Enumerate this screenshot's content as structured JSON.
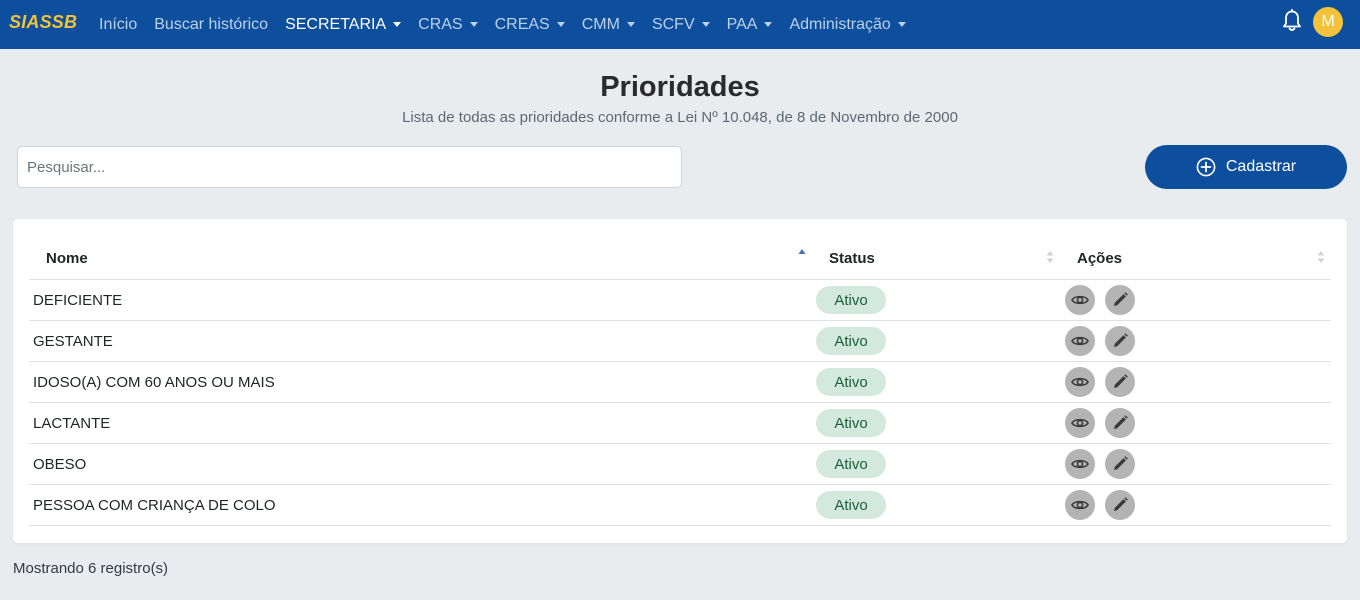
{
  "navbar": {
    "brand": "SIASSB",
    "items": [
      {
        "label": "Início",
        "dropdown": false,
        "active": false
      },
      {
        "label": "Buscar histórico",
        "dropdown": false,
        "active": false
      },
      {
        "label": "SECRETARIA",
        "dropdown": true,
        "active": true
      },
      {
        "label": "CRAS",
        "dropdown": true,
        "active": false
      },
      {
        "label": "CREAS",
        "dropdown": true,
        "active": false
      },
      {
        "label": "CMM",
        "dropdown": true,
        "active": false
      },
      {
        "label": "SCFV",
        "dropdown": true,
        "active": false
      },
      {
        "label": "PAA",
        "dropdown": true,
        "active": false
      },
      {
        "label": "Administração",
        "dropdown": true,
        "active": false
      }
    ],
    "avatar_initial": "M"
  },
  "header": {
    "title": "Prioridades",
    "subtitle": "Lista de todas as prioridades conforme a Lei Nº 10.048, de 8 de Novembro de 2000"
  },
  "search": {
    "placeholder": "Pesquisar...",
    "value": ""
  },
  "add_button": {
    "label": "Cadastrar"
  },
  "table": {
    "columns": [
      "Nome",
      "Status",
      "Ações"
    ],
    "rows": [
      {
        "nome": "DEFICIENTE",
        "status": "Ativo"
      },
      {
        "nome": "GESTANTE",
        "status": "Ativo"
      },
      {
        "nome": "IDOSO(A) COM 60 ANOS OU MAIS",
        "status": "Ativo"
      },
      {
        "nome": "LACTANTE",
        "status": "Ativo"
      },
      {
        "nome": "OBESO",
        "status": "Ativo"
      },
      {
        "nome": "PESSOA COM CRIANÇA DE COLO",
        "status": "Ativo"
      }
    ]
  },
  "footer": {
    "count_text": "Mostrando 6 registro(s)"
  },
  "icons": {
    "bell": "bell-icon",
    "add": "plus-circle-icon",
    "view": "eye-icon",
    "edit": "pencil-icon",
    "sort": "sort-icon"
  },
  "colors": {
    "navbar": "#0d4f9c",
    "brand": "#f2c23a",
    "background": "#e9ecef",
    "badge_bg": "#d3e9dd",
    "badge_text": "#1d5e3c",
    "action_button": "#b4b4b4"
  }
}
